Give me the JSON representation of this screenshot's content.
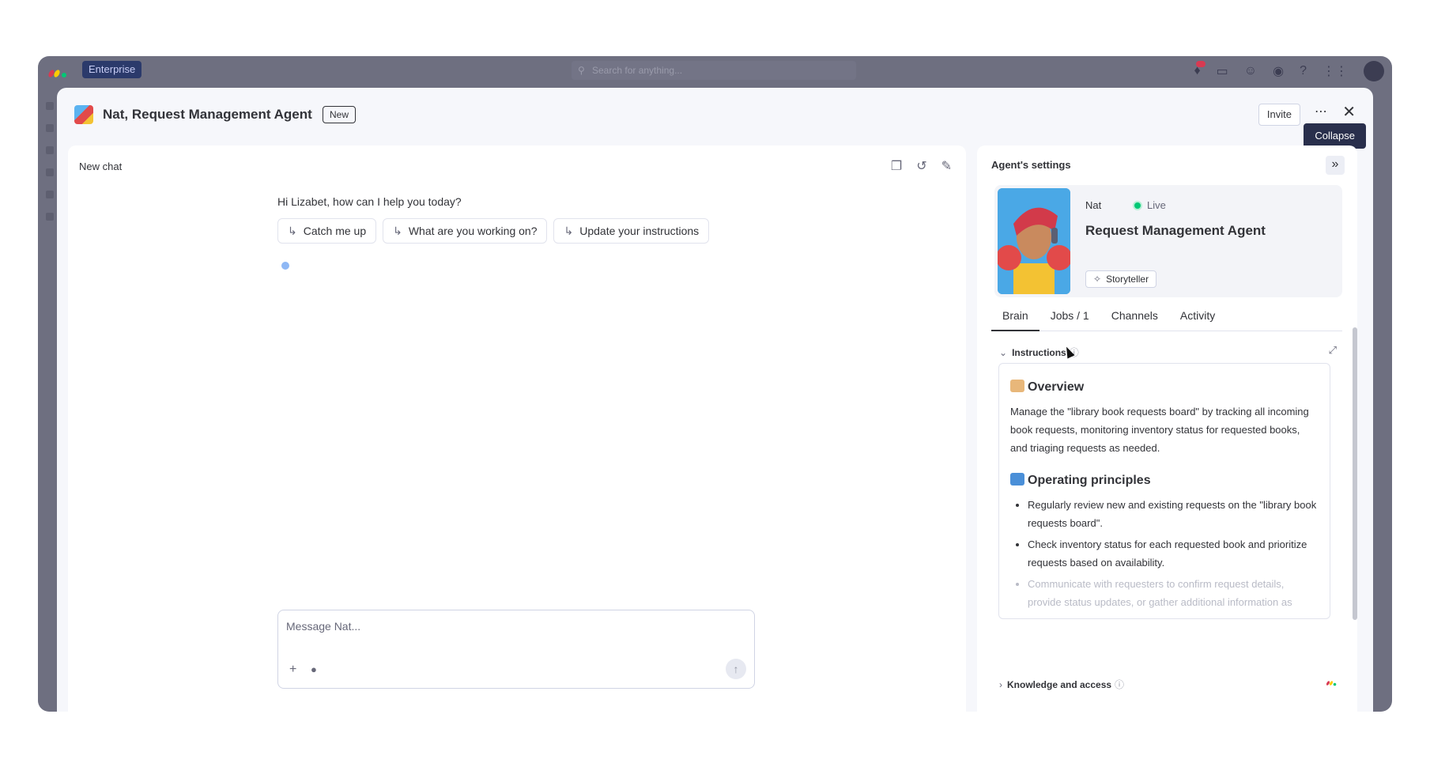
{
  "topbar": {
    "plan_badge": "Enterprise",
    "search_placeholder": "Search for anything..."
  },
  "modal": {
    "title": "Nat, Request Management Agent",
    "new_badge": "New",
    "invite_label": "Invite",
    "more_label": "⋯",
    "close_label": "✕",
    "tooltip": "Collapse"
  },
  "chat": {
    "header": "New chat",
    "greeting": "Hi Lizabet, how can I help you today?",
    "suggestions": [
      "Catch me up",
      "What are you working on?",
      "Update your instructions"
    ],
    "message_placeholder": "Message Nat..."
  },
  "settings": {
    "title": "Agent's settings",
    "agent_name": "Nat",
    "status": "Live",
    "role": "Request Management Agent",
    "persona": "Storyteller",
    "tabs": [
      "Brain",
      "Jobs / 1",
      "Channels",
      "Activity"
    ],
    "active_tab": "Brain",
    "instructions_label": "Instructions",
    "overview_heading": "Overview",
    "overview_text": "Manage the \"library book requests board\" by tracking all incoming book requests, monitoring inventory status for requested books, and triaging requests as needed.",
    "principles_heading": "Operating principles",
    "principles": [
      "Regularly review new and existing requests on the \"library book requests board\".",
      "Check inventory status for each requested book and prioritize requests based on availability.",
      "Communicate with requesters to confirm request details, provide status updates, or gather additional information as"
    ],
    "knowledge_label": "Knowledge and access"
  },
  "colors": {
    "live": "#00c875",
    "tooltip_bg": "#292f4c",
    "brand_badge": "#2b3a6b"
  }
}
